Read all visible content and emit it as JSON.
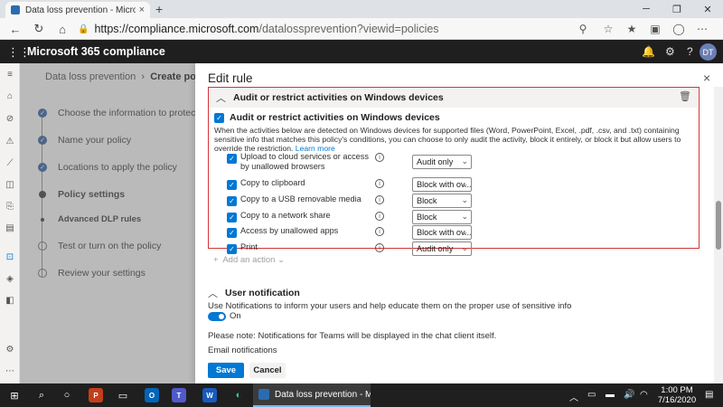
{
  "browser": {
    "tab_title": "Data loss prevention - Microsoft",
    "tab_close": "×",
    "new_tab": "+",
    "url_domain": "https://compliance.microsoft.com",
    "url_path": "/datalossprevention?viewid=policies"
  },
  "app": {
    "name": "Microsoft 365 compliance",
    "avatar_initials": "DT"
  },
  "breadcrumb": {
    "parent": "Data loss prevention",
    "separator": "›",
    "current": "Create policy"
  },
  "steps": [
    {
      "label": "Choose the information to protect",
      "state": "done"
    },
    {
      "label": "Name your policy",
      "state": "done"
    },
    {
      "label": "Locations to apply the policy",
      "state": "done"
    },
    {
      "label": "Policy settings",
      "state": "current"
    },
    {
      "label": "Advanced DLP rules",
      "state": "sub"
    },
    {
      "label": "Test or turn on the policy",
      "state": "todo"
    },
    {
      "label": "Review your settings",
      "state": "todo"
    }
  ],
  "panel": {
    "title": "Edit rule",
    "close": "×",
    "section_title": "Audit or restrict activities on Windows devices",
    "checkbox_label": "Audit or restrict activities on Windows devices",
    "description": "When the activities below are detected on Windows devices for supported files (Word, PowerPoint, Excel, .pdf, .csv, and .txt) containing sensitive info that matches this policy's conditions, you can choose to only audit the activity, block it entirely, or block it but allow users to override the restriction.",
    "learn_more": "Learn more",
    "activities": [
      {
        "label": "Upload to cloud services or access by unallowed browsers",
        "checked": true,
        "value": "Audit only"
      },
      {
        "label": "Copy to clipboard",
        "checked": true,
        "value": "Block with ov..."
      },
      {
        "label": "Copy to a USB removable media",
        "checked": true,
        "value": "Block"
      },
      {
        "label": "Copy to a network share",
        "checked": true,
        "value": "Block"
      },
      {
        "label": "Access by unallowed apps",
        "checked": true,
        "value": "Block with ov..."
      },
      {
        "label": "Print",
        "checked": true,
        "value": "Audit only"
      }
    ],
    "add_action": "Add an action",
    "user_notification": {
      "heading": "User notification",
      "description": "Use Notifications to inform your users and help educate them on the proper use of sensitive info",
      "toggle_label": "On",
      "toggle_on": true,
      "note": "Please note: Notifications for Teams will be displayed in the chat client itself.",
      "email_heading": "Email notifications"
    },
    "save_label": "Save",
    "cancel_label": "Cancel"
  },
  "taskbar": {
    "active_window": "Data loss prevention - Micro...",
    "time": "1:00 PM",
    "date": "7/16/2020"
  },
  "colors": {
    "accent": "#0078d4",
    "highlight_border": "#d13438",
    "app_header": "#1f1f1f"
  }
}
